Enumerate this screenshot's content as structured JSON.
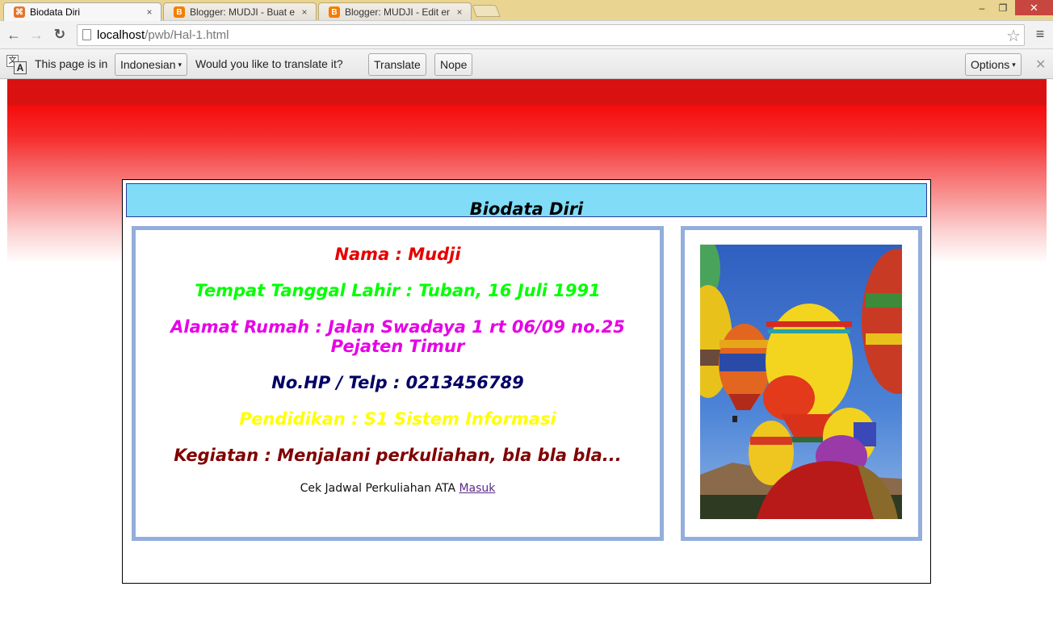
{
  "browser": {
    "tabs": [
      {
        "title": "Biodata Diri",
        "icon": "xampp-favicon",
        "active": true
      },
      {
        "title": "Blogger: MUDJI - Buat ent",
        "icon": "blogger-favicon",
        "active": false
      },
      {
        "title": "Blogger: MUDJI - Edit entr",
        "icon": "blogger-favicon",
        "active": false
      }
    ],
    "tab_close_glyph": "×",
    "window_controls": {
      "minimize": "–",
      "maximize": "❐",
      "close": "✕"
    },
    "nav": {
      "back": "←",
      "forward": "→",
      "reload": "↻"
    },
    "url": {
      "host": "localhost",
      "path": "/pwb/Hal-1.html"
    },
    "star_glyph": "☆",
    "menu_glyph": "≡"
  },
  "translate_bar": {
    "prefix": "This page is in",
    "language": "Indonesian",
    "question": "Would you like to translate it?",
    "translate_label": "Translate",
    "nope_label": "Nope",
    "options_label": "Options",
    "caret": "▾",
    "close_glyph": "✕",
    "icon_glyph_a": "文",
    "icon_glyph_b": "A"
  },
  "page": {
    "colors": {
      "header_bg": "#80dcf7",
      "box_border": "#93aedc",
      "banner_red": "#f50d0d"
    },
    "header_title": "Biodata Diri",
    "info": [
      {
        "label": "Nama : Mudji",
        "color": "#e60000"
      },
      {
        "label": "Tempat Tanggal Lahir : Tuban, 16 Juli 1991",
        "color": "#00ff00"
      },
      {
        "label": "Alamat Rumah : Jalan Swadaya 1 rt 06/09 no.25 Pejaten Timur",
        "color": "#e600e6"
      },
      {
        "label": "No.HP / Telp : 0213456789",
        "color": "#000066"
      },
      {
        "label": "Pendidikan : S1 Sistem Informasi",
        "color": "#ffff00"
      },
      {
        "label": "Kegiatan : Menjalani perkuliahan, bla bla bla...",
        "color": "#800000"
      }
    ],
    "footer_text": "Cek Jadwal Perkuliahan ATA ",
    "footer_link": "Masuk",
    "photo_alt": "Hot air balloons"
  }
}
